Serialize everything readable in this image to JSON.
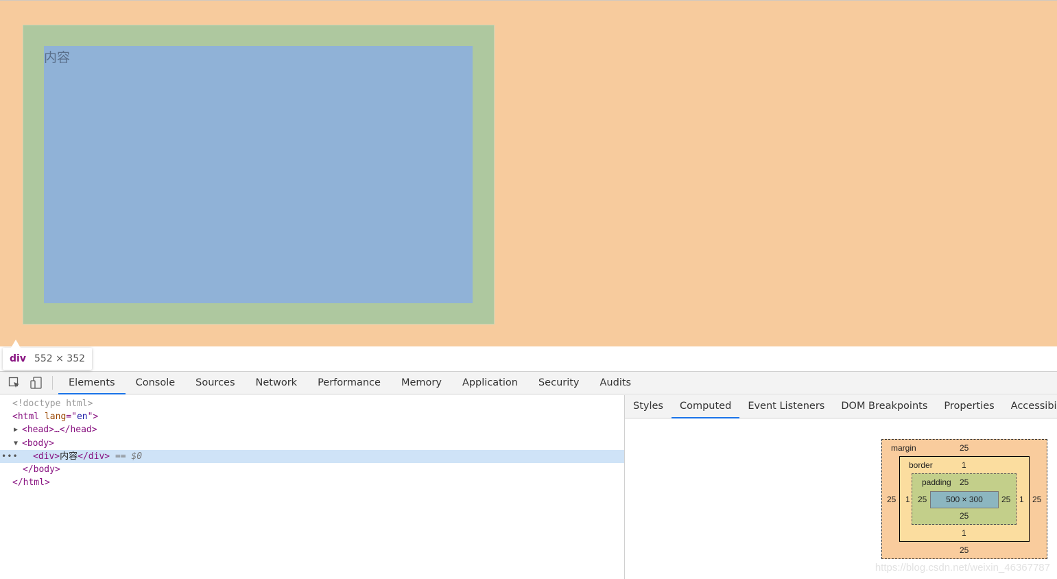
{
  "page": {
    "content_text": "内容"
  },
  "tooltip": {
    "tag": "div",
    "size": "552 × 352"
  },
  "toolbar": {
    "tabs": [
      "Elements",
      "Console",
      "Sources",
      "Network",
      "Performance",
      "Memory",
      "Application",
      "Security",
      "Audits"
    ],
    "active_tab": "Elements"
  },
  "dom_tree": {
    "doctype": "<!doctype html>",
    "html_open_tag": "<html",
    "html_attr": " lang",
    "html_eq": "=\"",
    "html_val": "en",
    "html_close": "\">",
    "head": "<head>…</head>",
    "body_open": "<body>",
    "div_open": "<div>",
    "div_text": "内容",
    "div_close": "</div>",
    "selected_marker": " == $0",
    "body_close": "</body>",
    "html_end": "</html>",
    "ellipsis": "•••"
  },
  "sidebar": {
    "tabs": [
      "Styles",
      "Computed",
      "Event Listeners",
      "DOM Breakpoints",
      "Properties",
      "Accessibility"
    ],
    "active_tab": "Computed"
  },
  "box_model": {
    "margin_label": "margin",
    "border_label": "border",
    "padding_label": "padding",
    "margin": {
      "top": "25",
      "right": "25",
      "bottom": "25",
      "left": "25"
    },
    "border": {
      "top": "1",
      "right": "1",
      "bottom": "1",
      "left": "1"
    },
    "padding": {
      "top": "25",
      "right": "25",
      "bottom": "25",
      "left": "25"
    },
    "content": "500 × 300"
  },
  "watermark": "https://blog.csdn.net/weixin_46367787",
  "colors": {
    "margin": "#f7cb9d",
    "padding": "#aec89f",
    "content": "#90b2d7",
    "accent": "#1a73e8"
  }
}
